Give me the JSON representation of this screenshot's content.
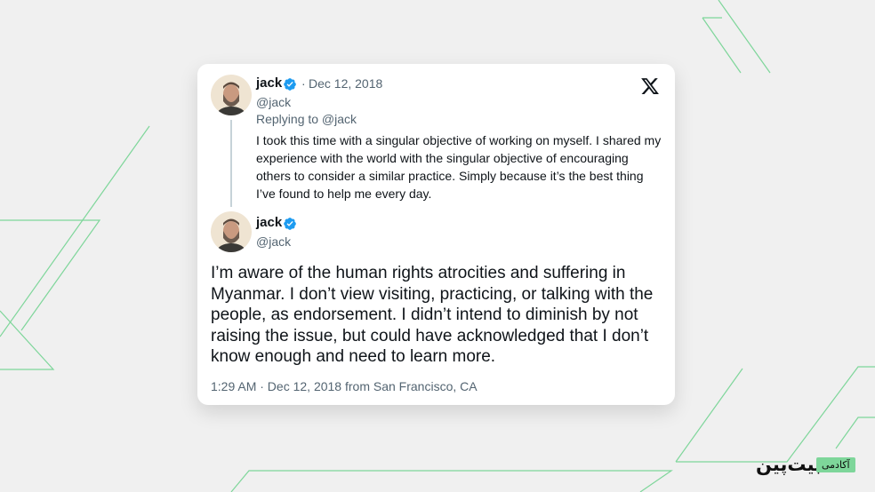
{
  "colors": {
    "background": "#f0f0f0",
    "accent_line": "#7ed69a",
    "verified": "#1d9bf0",
    "muted_text": "#536471"
  },
  "reply_tweet": {
    "name": "jack",
    "handle": "@jack",
    "date": "Dec 12, 2018",
    "separator": "·",
    "replying_to": "Replying to @jack",
    "text": "I took this time with a singular objective of working on myself. I shared my experience with the world with the singular objective of encouraging others to consider a similar practice. Simply because it’s the best thing I’ve found to help me every day."
  },
  "main_tweet": {
    "name": "jack",
    "handle": "@jack",
    "text": "I’m aware of the human rights atrocities and suffering in Myanmar. I don’t view visiting, practicing, or talking with the people, as endorsement. I didn’t intend to diminish by not raising the issue, but could have acknowledged that I don’t know enough and need to learn more.",
    "meta": "1:29 AM · Dec 12, 2018 from San Francisco, CA"
  },
  "icons": {
    "platform": "x-logo-icon",
    "verified": "verified-badge-icon"
  },
  "brand": {
    "name": "بیت‌پین",
    "tag": "آکادمی"
  }
}
